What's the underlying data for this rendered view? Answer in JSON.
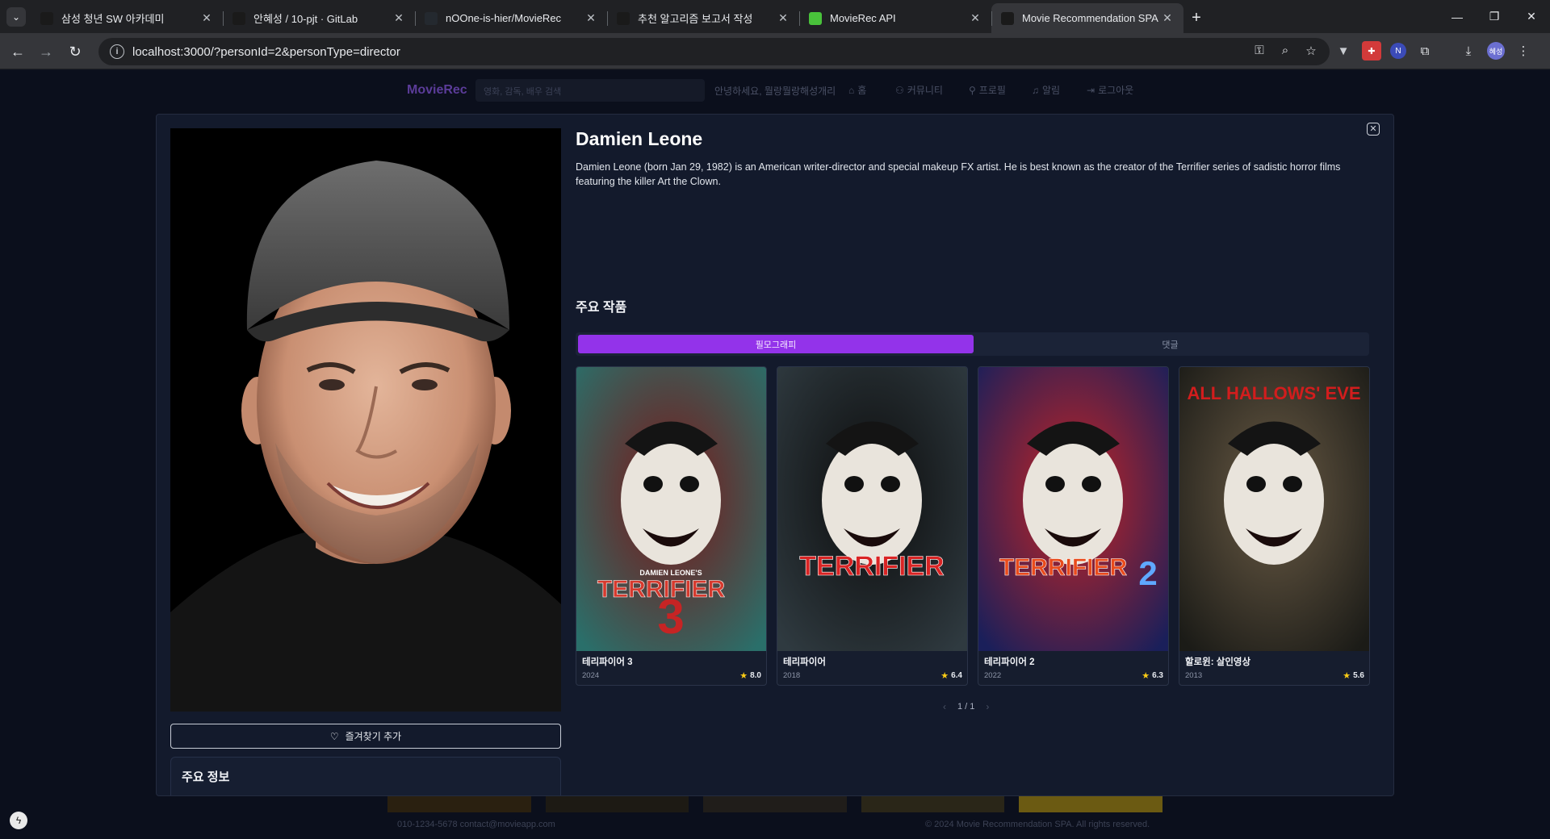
{
  "browser": {
    "tabs": [
      {
        "title": "삼성 청년 SW 아카데미",
        "favicon_color": "#1a1a1a",
        "active": false
      },
      {
        "title": "안혜성 / 10-pjt · GitLab",
        "favicon_color": "#1a1a1a",
        "active": false
      },
      {
        "title": "nOOne-is-hier/MovieRec",
        "favicon_color": "#24292f",
        "active": false
      },
      {
        "title": "추천 알고리즘 보고서 작성",
        "favicon_color": "#1a1a1a",
        "active": false
      },
      {
        "title": "MovieRec API",
        "favicon_color": "#49c23b",
        "active": false
      },
      {
        "title": "Movie Recommendation SPA",
        "favicon_color": "#1a1a1a",
        "active": true
      }
    ],
    "url": "localhost:3000/?personId=2&personType=director",
    "profile_initials": "혜성"
  },
  "app": {
    "logo": "MovieRec",
    "search_placeholder": "영화, 감독, 배우 검색",
    "greeting": "안녕하세요, 뭘랑뭘랑해성개리",
    "nav": [
      {
        "label": "홈",
        "icon": "home-icon"
      },
      {
        "label": "커뮤니티",
        "icon": "users-icon"
      },
      {
        "label": "프로필",
        "icon": "user-icon"
      },
      {
        "label": "알림",
        "icon": "bell-icon"
      },
      {
        "label": "로그아웃",
        "icon": "logout-icon"
      }
    ],
    "footer": {
      "contact": "010-1234-5678    contact@movieapp.com",
      "copyright": "© 2024 Movie Recommendation SPA. All rights reserved."
    }
  },
  "person": {
    "name": "Damien Leone",
    "bio": "Damien Leone (born Jan 29, 1982) is an American writer-director and special makeup FX artist. He is best known as the creator of the Terrifier series of sadistic horror films featuring the killer Art the Clown.",
    "favorite_button": "즐겨찾기 추가",
    "info_section_title": "주요 정보"
  },
  "works": {
    "section_title": "주요 작품",
    "tabs": [
      {
        "label": "필모그래피",
        "active": true
      },
      {
        "label": "댓글",
        "active": false
      }
    ],
    "movies": [
      {
        "title": "테리파이어 3",
        "year": "2024",
        "rating": "8.0",
        "poster_text": "TERRIFIER",
        "poster_num": "3",
        "poster_top": "DAMIEN LEONE'S",
        "palette": [
          "#2a6f6a",
          "#7a1717",
          "#d63a2e"
        ]
      },
      {
        "title": "테리파이어",
        "year": "2018",
        "rating": "6.4",
        "poster_text": "TERRIFIER",
        "poster_num": "",
        "poster_top": "",
        "palette": [
          "#2f3a40",
          "#0c0c0c",
          "#d92424"
        ]
      },
      {
        "title": "테리파이어 2",
        "year": "2022",
        "rating": "6.3",
        "poster_text": "TERRIFIER",
        "poster_num": "2",
        "poster_top": "",
        "palette": [
          "#1a1f5a",
          "#c62424",
          "#e94b1c"
        ]
      },
      {
        "title": "할로윈: 살인영상",
        "year": "2013",
        "rating": "5.6",
        "poster_text": "",
        "poster_num": "",
        "poster_top": "ALL HALLOWS' EVE",
        "palette": [
          "#1b1b17",
          "#6a5b45",
          "#d21d1d"
        ]
      }
    ],
    "pager": "1 / 1"
  }
}
